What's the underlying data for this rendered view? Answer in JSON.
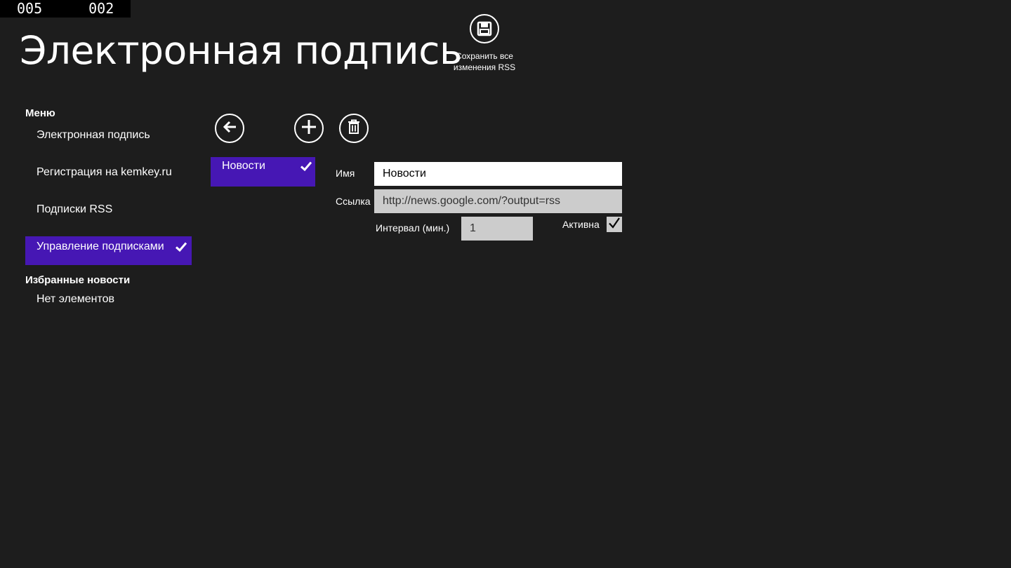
{
  "counter": {
    "left": "005",
    "right": "002"
  },
  "app": {
    "title": "Электронная подпись"
  },
  "appbar": {
    "save": {
      "label_line1": "Сохранить все",
      "label_line2": "изменения RSS",
      "icon": "save-icon"
    }
  },
  "sidebar": {
    "menu_heading": "Меню",
    "items": [
      {
        "label": "Электронная подпись",
        "selected": false
      },
      {
        "label": "Регистрация на kemkey.ru",
        "selected": false
      },
      {
        "label": "Подписки RSS",
        "selected": false
      },
      {
        "label": "Управление подписками",
        "selected": true
      }
    ],
    "favorites_heading": "Избранные новости",
    "favorites_empty": "Нет элементов"
  },
  "toolbar": {
    "back_icon": "arrow-left-icon",
    "add_icon": "plus-icon",
    "delete_icon": "trash-icon"
  },
  "feeds": [
    {
      "label": "Новости",
      "selected": true
    }
  ],
  "form": {
    "name_label": "Имя",
    "name_value": "Новости",
    "url_label": "Ссылка",
    "url_value": "http://news.google.com/?output=rss",
    "interval_label": "Интервал (мин.)",
    "interval_value": "1",
    "active_label": "Активна",
    "active_checked": true
  },
  "colors": {
    "background": "#1d1d1d",
    "accent": "#4617b4"
  }
}
